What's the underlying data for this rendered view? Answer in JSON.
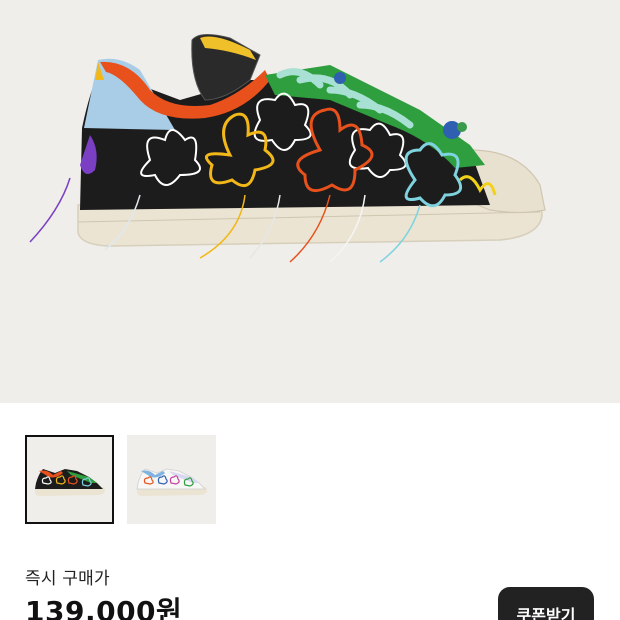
{
  "product": {
    "image_subject": "sneaker-hand-drawn-flowers",
    "thumbnails": [
      {
        "id": "thumb-1",
        "variant": "black",
        "selected": true
      },
      {
        "id": "thumb-2",
        "variant": "white",
        "selected": false
      }
    ]
  },
  "price_section": {
    "label": "즉시 구매가",
    "price": "139,000원",
    "coupon_button": "쿠폰받기"
  },
  "colors": {
    "hero_bg": "#efeeea",
    "button_bg": "#222222",
    "accent_green": "#2e9e3e",
    "accent_orange": "#e8511c"
  }
}
